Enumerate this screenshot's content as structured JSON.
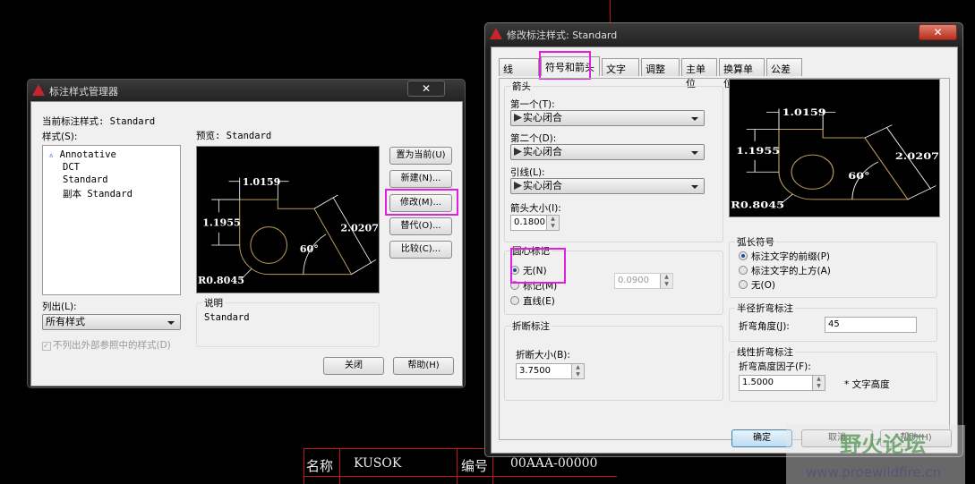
{
  "manager": {
    "title": "标注样式管理器",
    "close": "✕",
    "current_style_label": "当前标注样式: Standard",
    "styles_label": "样式(S):",
    "styles": [
      "Annotative",
      "DCT",
      "Standard",
      "副本 Standard"
    ],
    "preview_label": "预览: Standard",
    "list_label": "列出(L):",
    "list_value": "所有样式",
    "exclude_xref_label": "不列出外部参照中的样式(D)",
    "description_label": "说明",
    "description_value": "Standard",
    "buttons": {
      "set_current": "置为当前(U)",
      "new": "新建(N)...",
      "modify": "修改(M)...",
      "override": "替代(O)...",
      "compare": "比较(C)...",
      "close": "关闭",
      "help": "帮助(H)"
    }
  },
  "preview": {
    "dim_top": "1.0159",
    "dim_left": "1.1955",
    "dim_diag": "2.0207",
    "angle": "60°",
    "radius": "R0.8045"
  },
  "modify": {
    "title": "修改标注样式: Standard",
    "close": "✕",
    "tabs": [
      "线",
      "符号和箭头",
      "文字",
      "调整",
      "主单位",
      "换算单位",
      "公差"
    ],
    "arrowheads": {
      "group": "箭头",
      "first_label": "第一个(T):",
      "first_value": "实心闭合",
      "second_label": "第二个(D):",
      "second_value": "实心闭合",
      "leader_label": "引线(L):",
      "leader_value": "实心闭合",
      "size_label": "箭头大小(I):",
      "size_value": "0.1800"
    },
    "center_marks": {
      "group": "圆心标记",
      "none": "无(N)",
      "mark": "标记(M)",
      "line": "直线(E)",
      "size_value": "0.0900"
    },
    "dim_break": {
      "group": "折断标注",
      "size_label": "折断大小(B):",
      "size_value": "3.7500"
    },
    "arc_length": {
      "group": "弧长符号",
      "prefix": "标注文字的前缀(P)",
      "above": "标注文字的上方(A)",
      "none": "无(O)"
    },
    "radius_jog": {
      "group": "半径折弯标注",
      "angle_label": "折弯角度(J):",
      "angle_value": "45"
    },
    "linear_jog": {
      "group": "线性折弯标注",
      "factor_label": "折弯高度因子(F):",
      "factor_value": "1.5000",
      "suffix": "* 文字高度"
    },
    "buttons": {
      "ok": "确定",
      "cancel": "取消",
      "help": "帮助(H)"
    }
  },
  "titleblock": {
    "name_label": "名称",
    "name_value": "KUSOK",
    "code_label": "编号",
    "code_value": "00AAA-00000"
  },
  "watermark": {
    "text": "野火论坛",
    "url": "www.proewildfire.cn"
  }
}
